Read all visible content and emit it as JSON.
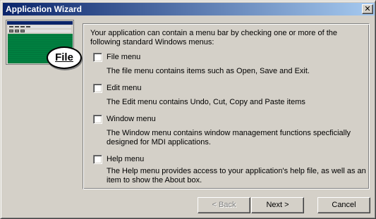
{
  "window": {
    "title": "Application Wizard",
    "close_glyph": "✕"
  },
  "preview": {
    "callout_label": "File"
  },
  "intro": "Your application can contain a menu bar by checking one or more of the following standard Windows menus:",
  "options": [
    {
      "label": "File menu",
      "checked": false,
      "description": "The file menu contains items such as Open, Save and Exit."
    },
    {
      "label": "Edit menu",
      "checked": false,
      "description": "The Edit menu contains Undo, Cut, Copy and Paste items"
    },
    {
      "label": "Window menu",
      "checked": false,
      "description": "The Window menu contains window management functions specficially designed for MDI applications."
    },
    {
      "label": "Help menu",
      "checked": false,
      "description": "The Help menu provides access to your application's help file, as well as an item to show the About box."
    }
  ],
  "buttons": {
    "back": "< Back",
    "next": "Next >",
    "cancel": "Cancel"
  },
  "colors": {
    "title_start": "#0a246a",
    "title_end": "#a6caf0",
    "dialog_face": "#d4d0c8",
    "preview_client": "#008040"
  },
  "icons": {
    "close": "close-icon"
  }
}
